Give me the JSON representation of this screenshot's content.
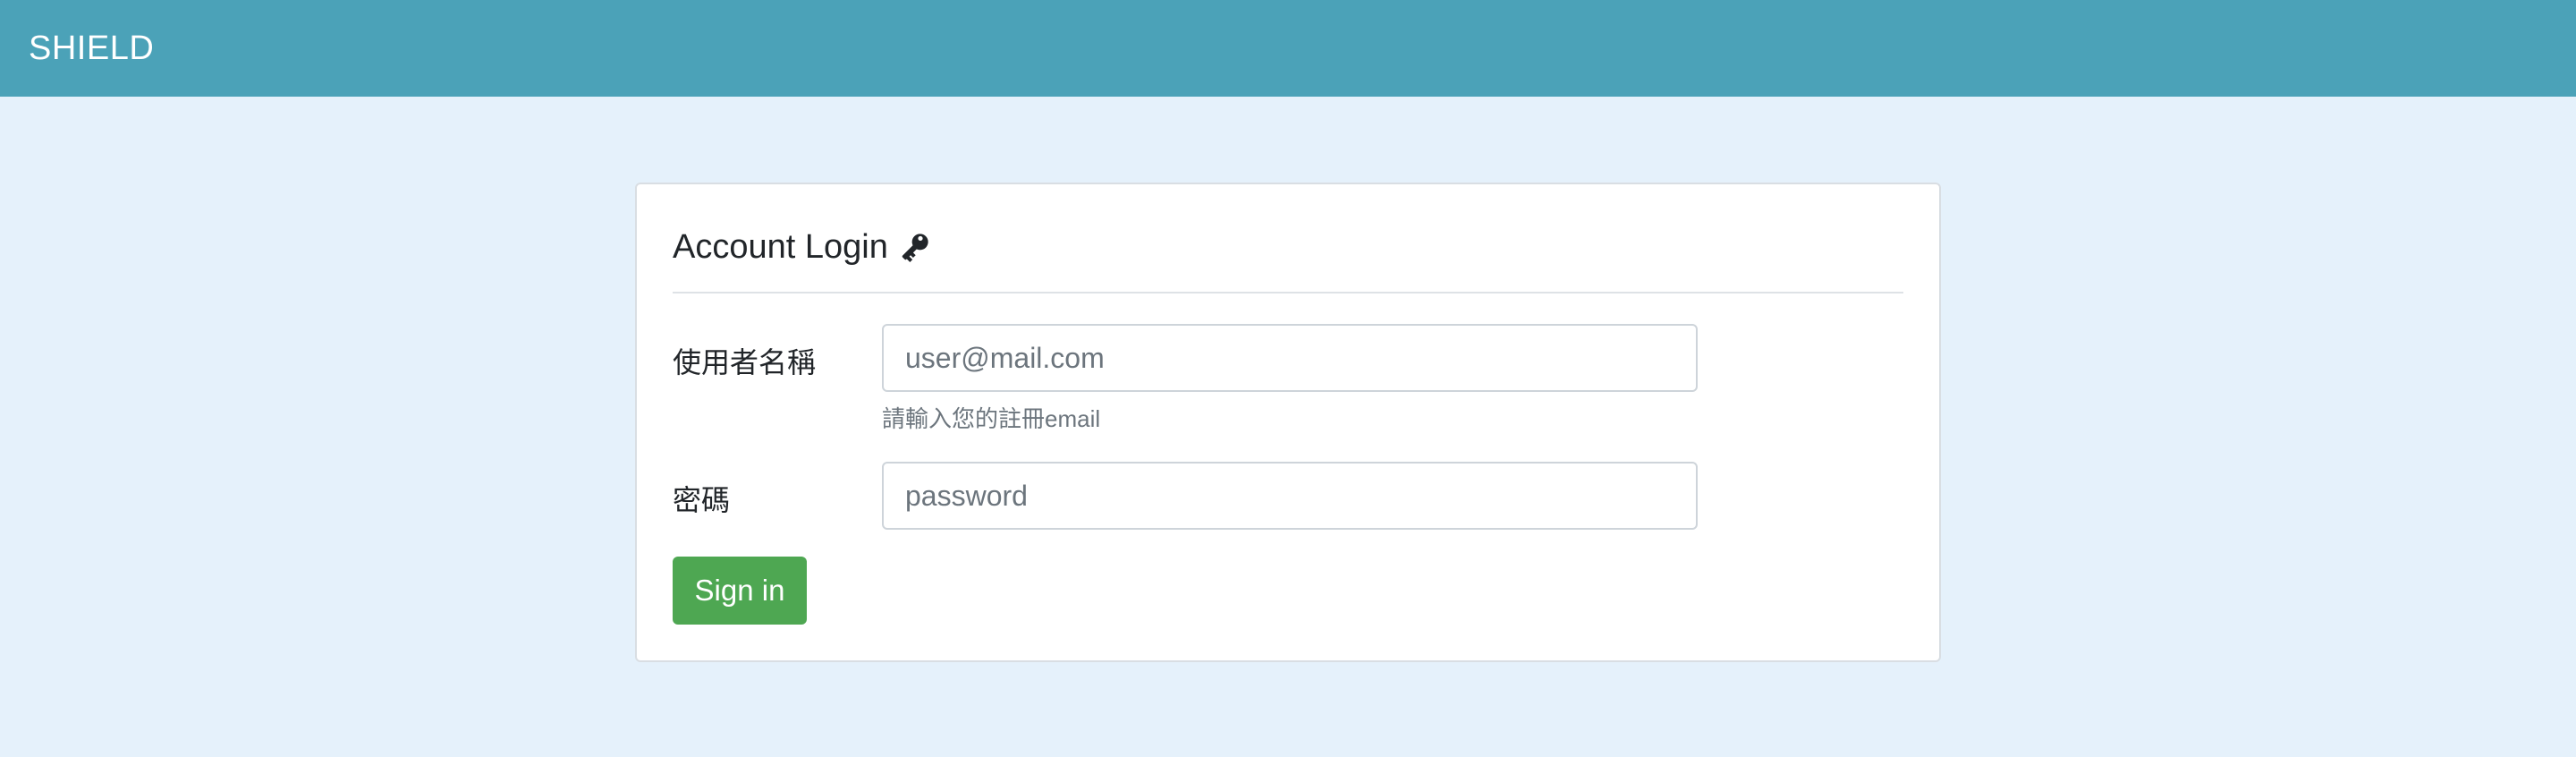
{
  "navbar": {
    "brand": "SHIELD",
    "background_color": "#4ba2b8"
  },
  "login_card": {
    "title": "Account Login",
    "title_icon": "key-icon",
    "username": {
      "label": "使用者名稱",
      "placeholder": "user@mail.com",
      "value": "",
      "help_text": "請輸入您的註冊email"
    },
    "password": {
      "label": "密碼",
      "placeholder": "password",
      "value": ""
    },
    "submit_label": "Sign in",
    "submit_color": "#4ea752"
  },
  "page_background": "#e5f1fb"
}
